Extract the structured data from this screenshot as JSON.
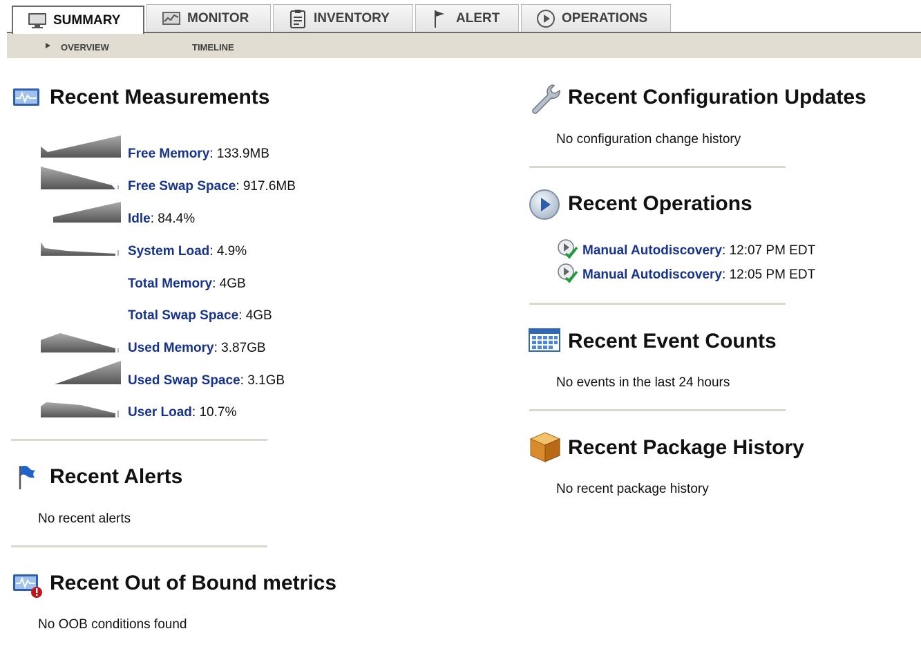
{
  "tabs": [
    {
      "label": "SUMMARY",
      "icon": "monitor-icon",
      "active": true
    },
    {
      "label": "MONITOR",
      "icon": "chart-icon"
    },
    {
      "label": "INVENTORY",
      "icon": "clipboard-icon"
    },
    {
      "label": "ALERT",
      "icon": "flag-icon"
    },
    {
      "label": "OPERATIONS",
      "icon": "play-icon"
    }
  ],
  "subnav": {
    "overview": "OVERVIEW",
    "timeline": "TIMELINE"
  },
  "measurements": {
    "title": "Recent Measurements",
    "items": [
      {
        "label": "Free Memory",
        "value": "133.9MB"
      },
      {
        "label": "Free Swap Space",
        "value": "917.6MB"
      },
      {
        "label": "Idle",
        "value": "84.4%"
      },
      {
        "label": "System Load",
        "value": "4.9%"
      },
      {
        "label": "Total Memory",
        "value": "4GB"
      },
      {
        "label": "Total Swap Space",
        "value": "4GB"
      },
      {
        "label": "Used Memory",
        "value": "3.87GB"
      },
      {
        "label": "Used Swap Space",
        "value": "3.1GB"
      },
      {
        "label": "User Load",
        "value": "10.7%"
      }
    ]
  },
  "alerts": {
    "title": "Recent Alerts",
    "empty": "No recent alerts"
  },
  "oob": {
    "title": "Recent Out of Bound metrics",
    "empty": "No OOB conditions found"
  },
  "config": {
    "title": "Recent Configuration Updates",
    "empty": "No configuration change history"
  },
  "operations": {
    "title": "Recent Operations",
    "items": [
      {
        "label": "Manual Autodiscovery",
        "time": "12:07 PM EDT"
      },
      {
        "label": "Manual Autodiscovery",
        "time": "12:05 PM EDT"
      }
    ]
  },
  "events": {
    "title": "Recent Event Counts",
    "empty": "No events in the last 24 hours"
  },
  "packages": {
    "title": "Recent Package History",
    "empty": "No recent package history"
  },
  "colors": {
    "link": "#17338c",
    "subnav_bg": "#e1ddd3",
    "rule": "#d9d8d1"
  }
}
